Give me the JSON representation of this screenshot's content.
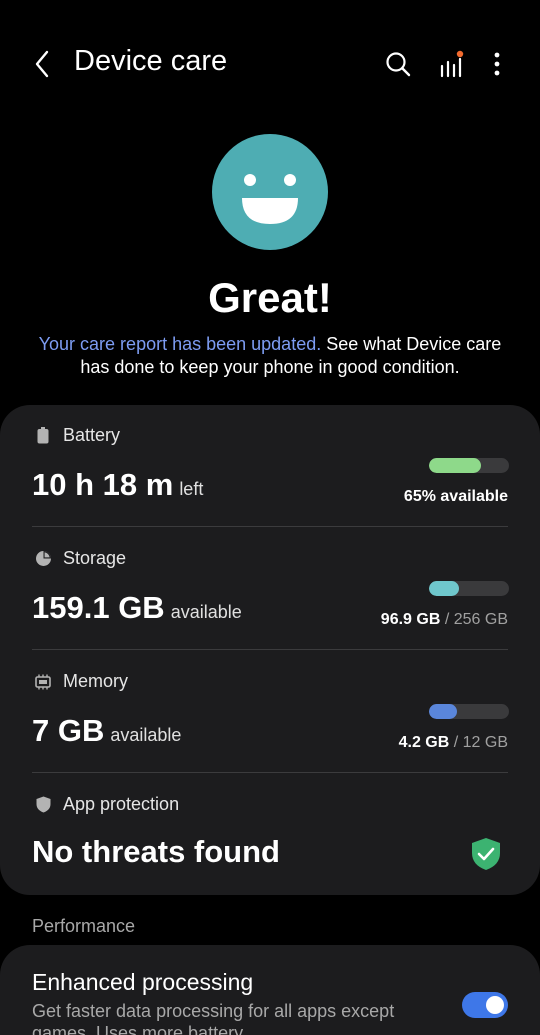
{
  "header": {
    "title": "Device care",
    "back_icon": "chevron-left-icon",
    "search_icon": "search-icon",
    "stats_icon": "signal-bars-icon",
    "more_icon": "more-vertical-icon",
    "notification_dot_color": "#f26a2e"
  },
  "status": {
    "face_icon": "smiley-face-icon",
    "face_color": "#4eadb3",
    "headline": "Great!",
    "report_link": "Your care report has been updated.",
    "report_text": " See what Device care has done to keep your phone in good condition."
  },
  "battery": {
    "label": "Battery",
    "icon": "battery-icon",
    "value": "10 h 18 m",
    "suffix": "left",
    "percent_text": "65% available",
    "level": 0.65,
    "bar_color": "#8ed98a"
  },
  "storage": {
    "label": "Storage",
    "icon": "storage-pie-icon",
    "value": "159.1 GB",
    "suffix": "available",
    "used": "96.9 GB",
    "total": "/ 256 GB",
    "level": 0.38,
    "bar_color": "#6fc7cc"
  },
  "memory": {
    "label": "Memory",
    "icon": "memory-chip-icon",
    "value": "7 GB",
    "suffix": "available",
    "used": "4.2 GB",
    "total": "/ 12 GB",
    "level": 0.35,
    "bar_color": "#5a86db"
  },
  "protection": {
    "label": "App protection",
    "icon": "shield-icon",
    "value": "No threats found",
    "status_icon": "shield-check-icon",
    "status_color": "#3cb371"
  },
  "performance": {
    "section_label": "Performance",
    "title": "Enhanced processing",
    "description": "Get faster data processing for all apps except games. Uses more battery.",
    "enabled": true
  }
}
